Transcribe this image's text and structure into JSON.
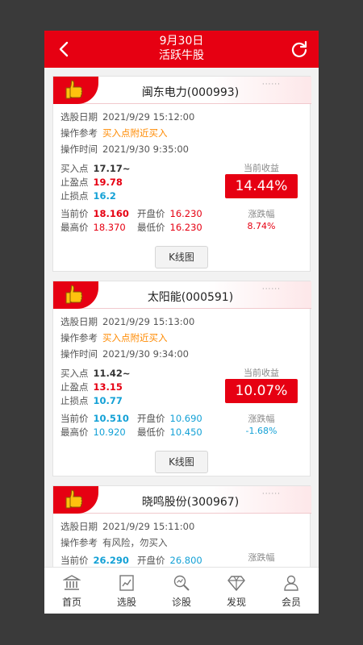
{
  "header": {
    "date": "9月30日",
    "title": "活跃牛股"
  },
  "labels": {
    "select_date": "选股日期",
    "operation_ref": "操作参考",
    "operation_time": "操作时间",
    "buy_point": "买入点",
    "take_profit": "止盈点",
    "stop_loss": "止损点",
    "current_price": "当前价",
    "open_price": "开盘价",
    "high_price": "最高价",
    "low_price": "最低价",
    "current_profit": "当前收益",
    "change_pct": "涨跌幅",
    "kline_button": "K线图",
    "dots": "······"
  },
  "stocks": [
    {
      "name": "闽东电力(000993)",
      "select_date": "2021/9/29 15:12:00",
      "operation": "买入点附近买入",
      "op_time": "2021/9/30 9:35:00",
      "buy": "17.17~",
      "take_profit": "19.78",
      "stop_loss": "16.2",
      "profit": "14.44%",
      "current": "18.160",
      "open": "16.230",
      "high": "18.370",
      "low": "16.230",
      "change": "8.74%"
    },
    {
      "name": "太阳能(000591)",
      "select_date": "2021/9/29 15:13:00",
      "operation": "买入点附近买入",
      "op_time": "2021/9/30 9:34:00",
      "buy": "11.42~",
      "take_profit": "13.15",
      "stop_loss": "10.77",
      "profit": "10.07%",
      "current": "10.510",
      "open": "10.690",
      "high": "10.920",
      "low": "10.450",
      "change": "-1.68%"
    },
    {
      "name": "晓鸣股份(300967)",
      "select_date": "2021/9/29 15:11:00",
      "operation": "有风险，勿买入",
      "current": "26.290",
      "open": "26.800"
    }
  ],
  "tabs": [
    {
      "label": "首页",
      "icon": "bank-icon"
    },
    {
      "label": "选股",
      "icon": "chart-doc-icon"
    },
    {
      "label": "诊股",
      "icon": "magnify-chart-icon"
    },
    {
      "label": "发现",
      "icon": "diamond-icon"
    },
    {
      "label": "会员",
      "icon": "user-icon"
    }
  ],
  "colors": {
    "brand_red": "#e60012",
    "orange": "#ff8a00",
    "blue": "#14a1d6"
  }
}
